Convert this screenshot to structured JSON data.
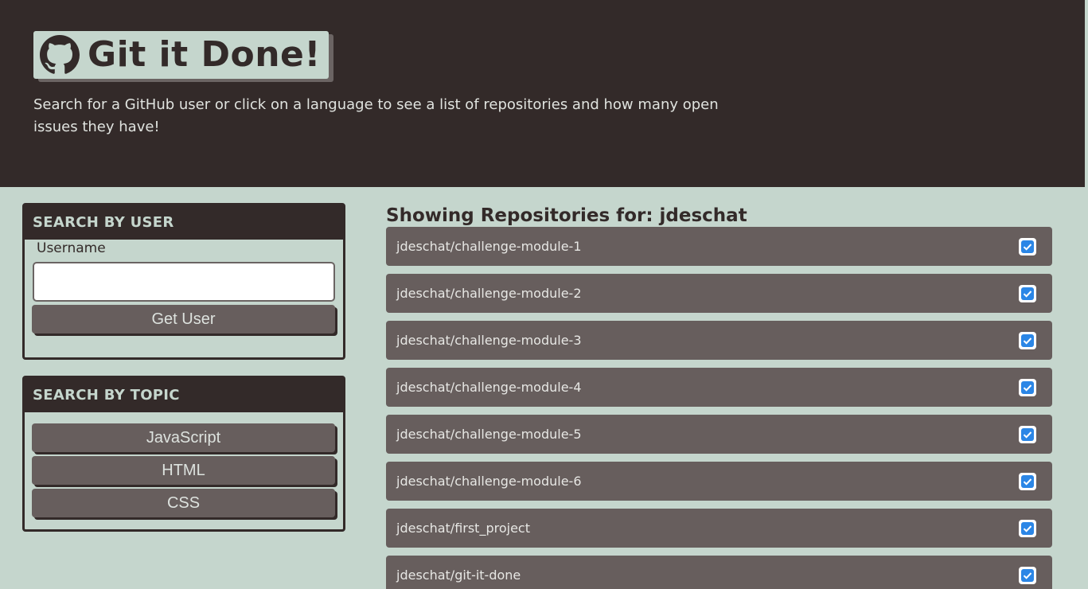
{
  "header": {
    "title": "Git it Done!",
    "subtitle": "Search for a GitHub user or click on a language to see a list of repositories and how many open issues they have!"
  },
  "user_search": {
    "heading": "SEARCH BY USER",
    "label": "Username",
    "input_value": "",
    "button_label": "Get User"
  },
  "topic_search": {
    "heading": "SEARCH BY TOPIC",
    "topics": [
      "JavaScript",
      "HTML",
      "CSS"
    ]
  },
  "results": {
    "title": "Showing Repositories for: jdeschat",
    "repos": [
      {
        "name": "jdeschat/challenge-module-1",
        "status": "check-icon"
      },
      {
        "name": "jdeschat/challenge-module-2",
        "status": "check-icon"
      },
      {
        "name": "jdeschat/challenge-module-3",
        "status": "check-icon"
      },
      {
        "name": "jdeschat/challenge-module-4",
        "status": "check-icon"
      },
      {
        "name": "jdeschat/challenge-module-5",
        "status": "check-icon"
      },
      {
        "name": "jdeschat/challenge-module-6",
        "status": "check-icon"
      },
      {
        "name": "jdeschat/first_project",
        "status": "check-icon"
      },
      {
        "name": "jdeschat/git-it-done",
        "status": "check-icon"
      }
    ]
  },
  "colors": {
    "dark": "#332a29",
    "background": "#c5d6cd",
    "button": "#675e5d",
    "check": "#2b86e6"
  }
}
